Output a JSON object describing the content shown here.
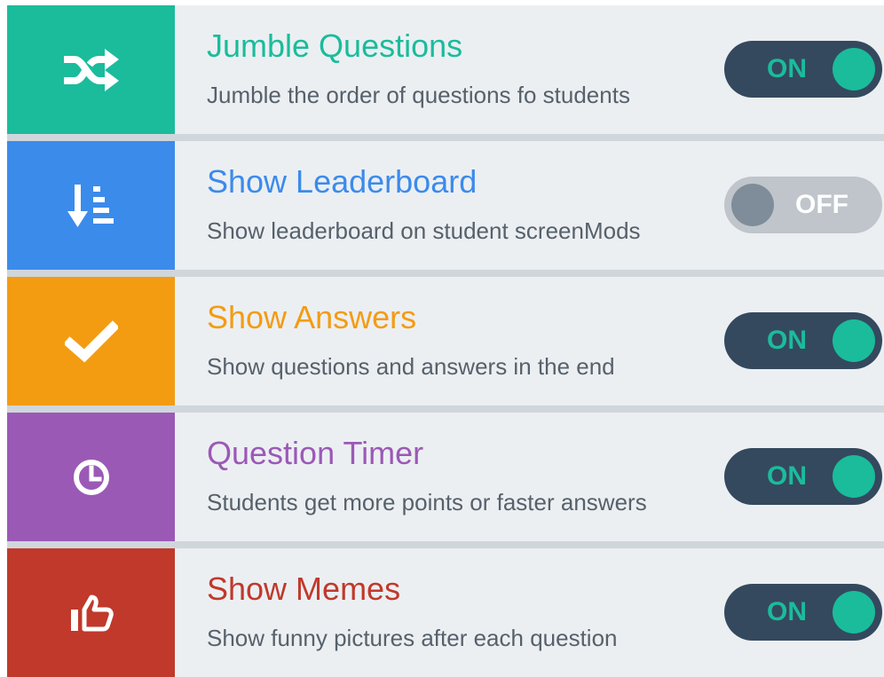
{
  "settings": [
    {
      "title": "Jumble Questions",
      "description": "Jumble the order of questions fo students",
      "toggle": "ON",
      "icon": "shuffle-icon",
      "color": "#1abc9c"
    },
    {
      "title": "Show Leaderboard",
      "description": "Show leaderboard on student screenMods",
      "toggle": "OFF",
      "icon": "sort-descending-icon",
      "color": "#3b8beb"
    },
    {
      "title": "Show Answers",
      "description": "Show questions and answers in the end",
      "toggle": "ON",
      "icon": "checkmark-icon",
      "color": "#f39c12"
    },
    {
      "title": "Question Timer",
      "description": "Students get more points or faster answers",
      "toggle": "ON",
      "icon": "clock-icon",
      "color": "#9b59b6"
    },
    {
      "title": "Show Memes",
      "description": "Show funny pictures after each question",
      "toggle": "ON",
      "icon": "thumbs-up-icon",
      "color": "#c0392b"
    }
  ],
  "colors": {
    "toggle_on_track": "#34495e",
    "toggle_on_knob": "#1abc9c",
    "toggle_off_track": "#bfc5ca",
    "toggle_off_knob": "#7f8c99",
    "row_background": "#eceff2",
    "divider": "#cfd6dc",
    "description_text": "#56616b"
  }
}
